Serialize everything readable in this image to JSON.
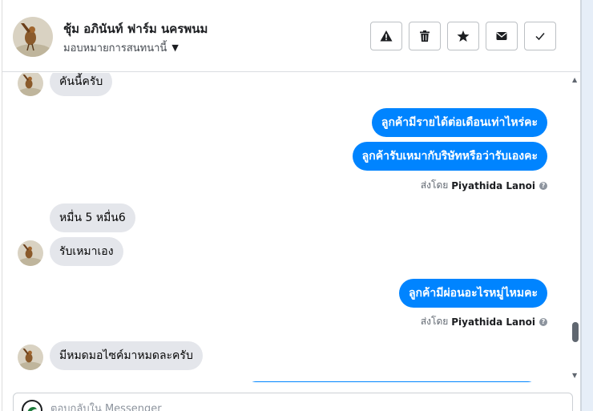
{
  "header": {
    "title": "ชุ้ม อภินันท์ ฟาร์ม นครพนม",
    "assign_label": "มอบหมายการสนทนานี้",
    "actions": [
      {
        "icon": "warning-icon",
        "name": "spam-button"
      },
      {
        "icon": "trash-icon",
        "name": "delete-button"
      },
      {
        "icon": "star-icon",
        "name": "star-button"
      },
      {
        "icon": "envelope-icon",
        "name": "mark-unread-button"
      },
      {
        "icon": "checkmark-icon",
        "name": "mark-done-button"
      }
    ]
  },
  "messages": {
    "m1": "คันนี้ครับ",
    "m2": "ลูกค้ามีรายได้ต่อเดือนเท่าไหร่คะ",
    "m3": "ลูกค้ารับเหมากับริษัทหรือว่ารับเองคะ",
    "sent1_prefix": "ส่งโดย",
    "sent1_name": "Piyathida Lanoi",
    "m4": "หมื่น 5 หมื่น6",
    "m5": "รับเหมาเอง",
    "m6": "ลูกค้ามีผ่อนอะไรหมู่ไหมคะ",
    "sent2_prefix": "ส่งโดย",
    "sent2_name": "Piyathida Lanoi",
    "m7": "มีหมดมอไซค์มาหมดละครับ"
  },
  "composer": {
    "placeholder": "ตอบกลับใน Messenger"
  },
  "colors": {
    "outgoing": "#0084ff",
    "incoming": "#e4e6eb"
  }
}
